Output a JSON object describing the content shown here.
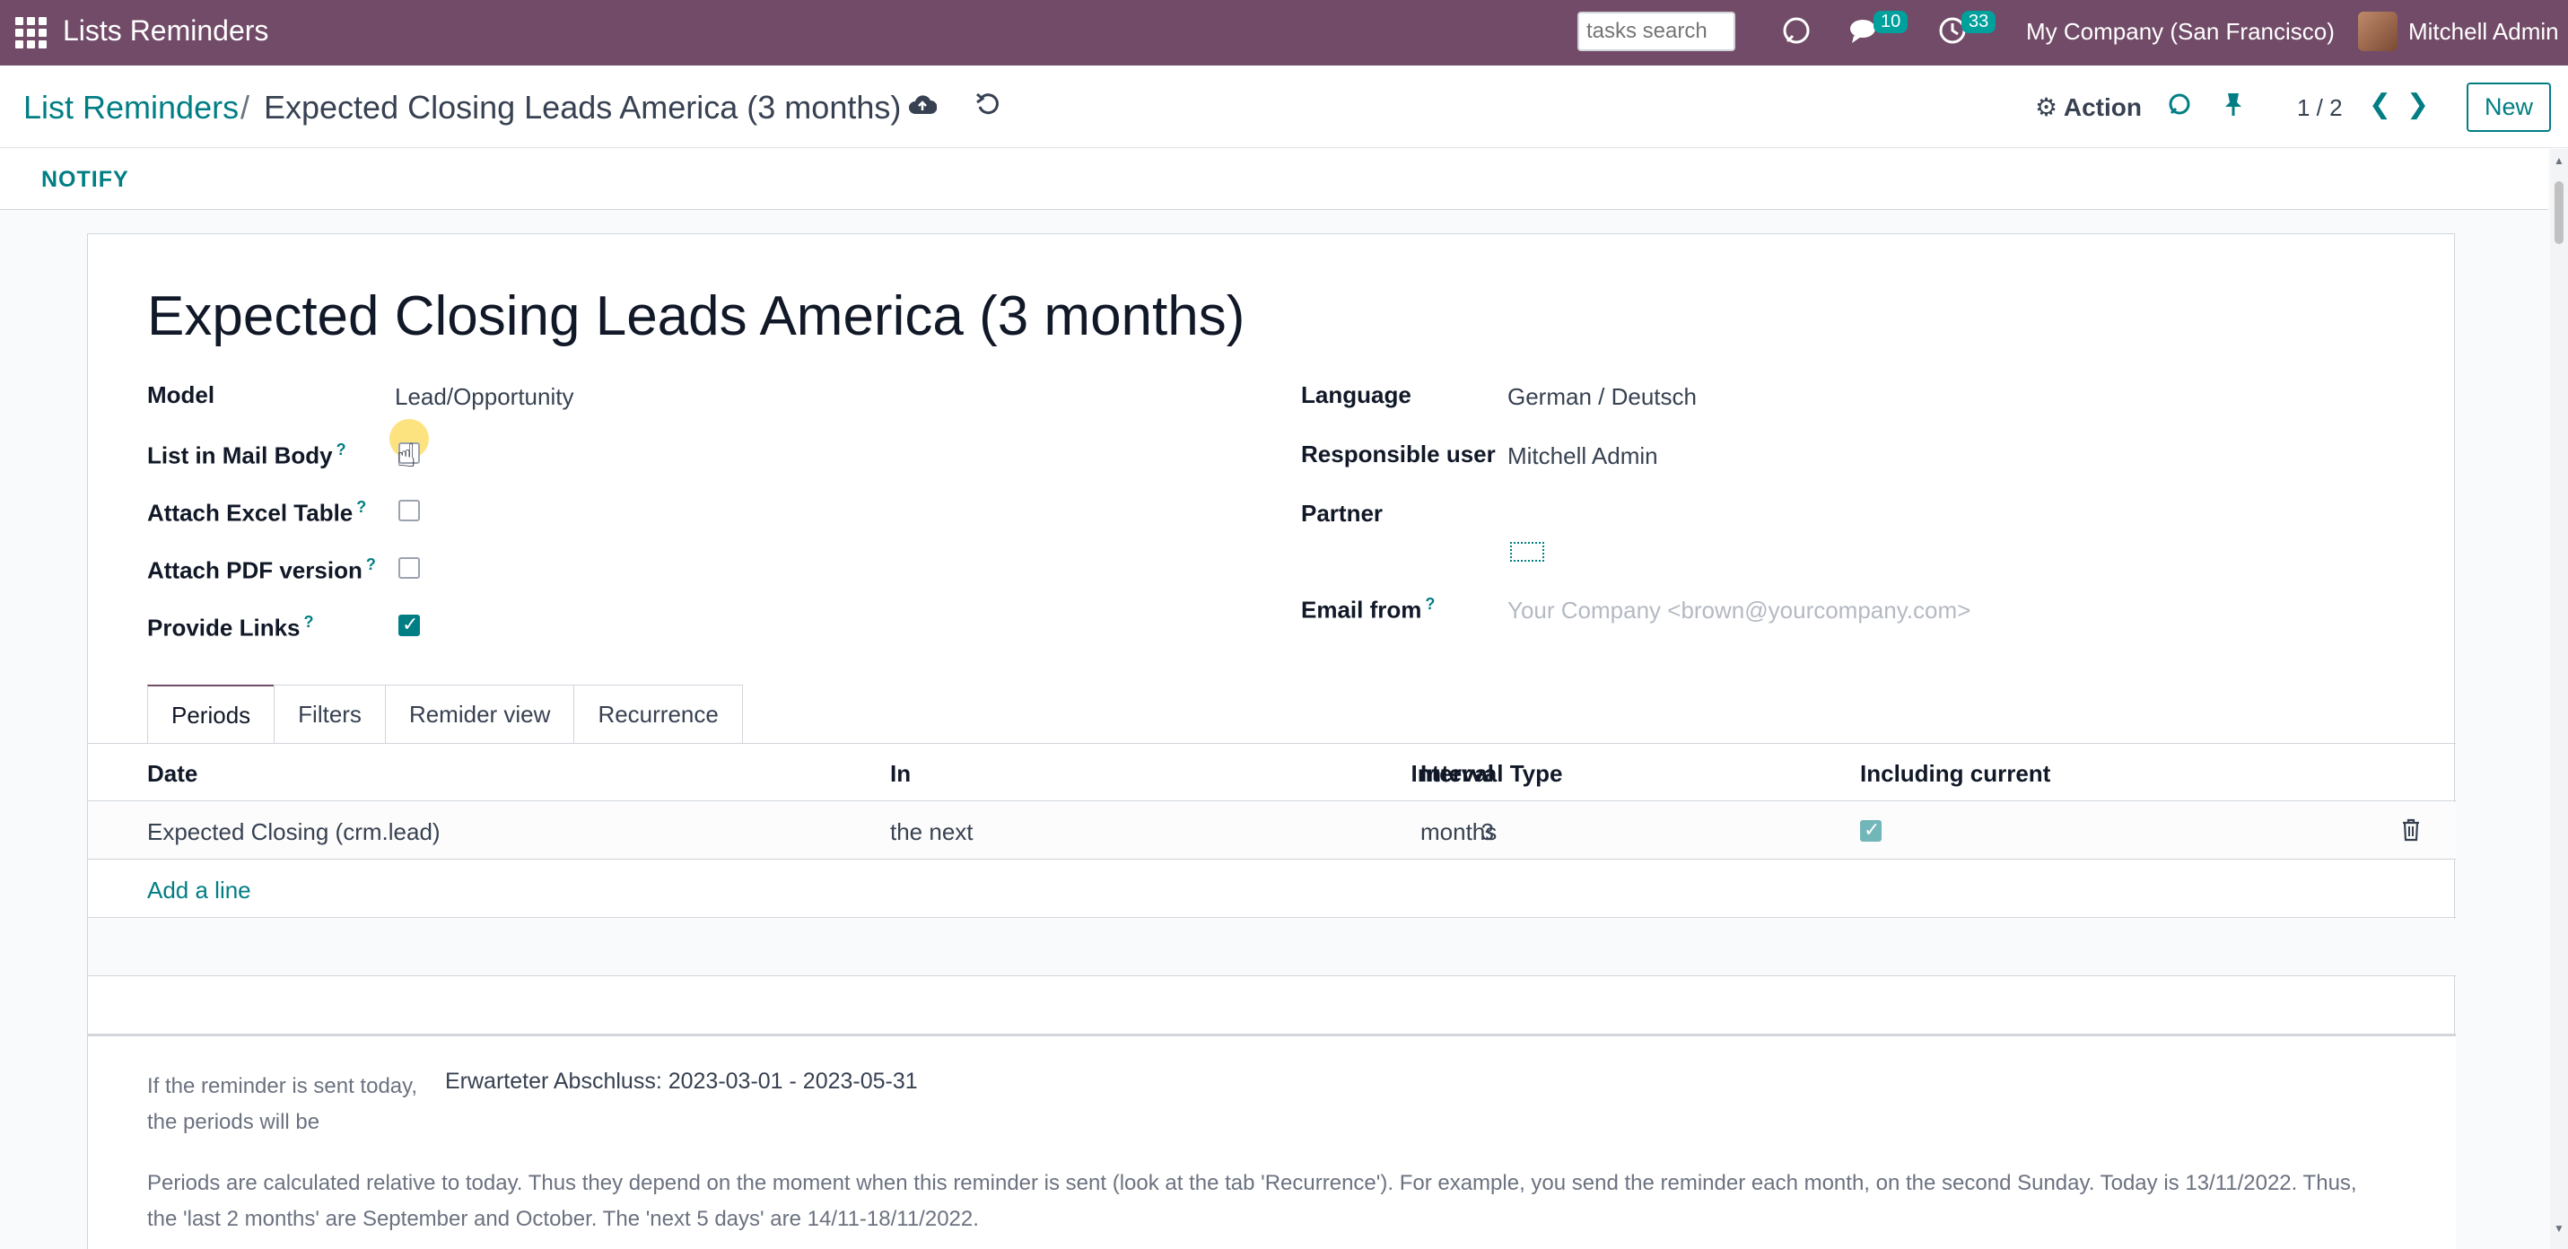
{
  "navbar": {
    "app_title": "Lists Reminders",
    "search_placeholder": "tasks search",
    "messages_count": "10",
    "activities_count": "33",
    "company": "My Company (San Francisco)",
    "user": "Mitchell Admin",
    "bg_color": "#714b67"
  },
  "control_panel": {
    "breadcrumb_parent": "List Reminders",
    "breadcrumb_separator": "/",
    "breadcrumb_current": "Expected Closing Leads America (3 months)",
    "action_label": "Action",
    "pager": "1 / 2",
    "new_label": "New"
  },
  "statusbar": {
    "notify_label": "NOTIFY"
  },
  "form": {
    "title": "Expected Closing Leads America (3 months)",
    "left": {
      "model_label": "Model",
      "model_value": "Lead/Opportunity",
      "list_in_mail_body_label": "List in Mail Body",
      "list_in_mail_body_checked": false,
      "attach_excel_label": "Attach Excel Table",
      "attach_excel_checked": false,
      "attach_pdf_label": "Attach PDF version",
      "attach_pdf_checked": false,
      "provide_links_label": "Provide Links",
      "provide_links_checked": true,
      "help_mark": "?"
    },
    "right": {
      "language_label": "Language",
      "language_value": "German / Deutsch",
      "responsible_label": "Responsible user",
      "responsible_value": "Mitchell Admin",
      "partner_label": "Partner",
      "email_from_label": "Email from",
      "email_from_placeholder": "Your Company <brown@yourcompany.com>"
    },
    "tabs": [
      "Periods",
      "Filters",
      "Remider view",
      "Recurrence"
    ],
    "active_tab": "Periods",
    "periods_table": {
      "headers": [
        "Date",
        "In",
        "Interval",
        "Interval Type",
        "Including current"
      ],
      "rows": [
        {
          "date": "Expected Closing (crm.lead)",
          "in": "the next",
          "interval": "3",
          "interval_type": "months",
          "including_current": true
        }
      ],
      "add_line": "Add a line"
    },
    "notes": {
      "label": "If the reminder is sent today, the periods will be",
      "value": "Erwarteter Abschluss: 2023-03-01 - 2023-05-31",
      "explanation": "Periods are calculated relative to today. Thus they depend on the moment when this reminder is sent (look at the tab 'Recurrence'). For example, you send the reminder each month, on the second Sunday. Today is 13/11/2022. Thus, the 'last 2 months' are September and October. The 'next 5 days' are 14/11-18/11/2022."
    }
  },
  "colors": {
    "accent": "#017e84",
    "brand": "#714b67"
  }
}
